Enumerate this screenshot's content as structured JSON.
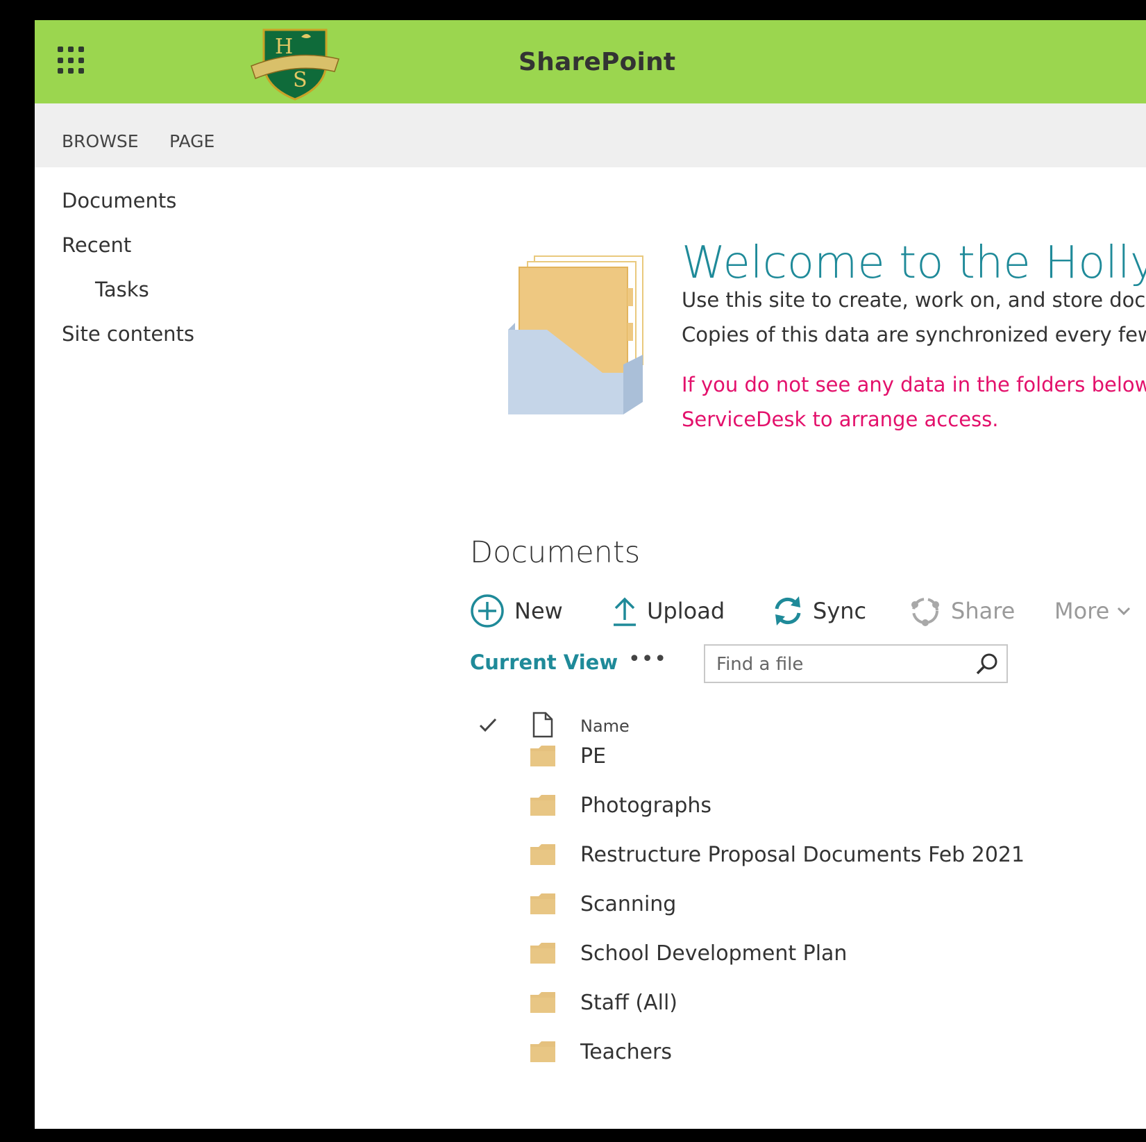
{
  "suite_bar": {
    "title": "SharePoint",
    "accent": "#9bd64f"
  },
  "ribbon": {
    "tabs": [
      "BROWSE",
      "PAGE"
    ]
  },
  "left_nav": {
    "items": [
      {
        "label": "Documents",
        "indent": false
      },
      {
        "label": "Recent",
        "indent": false
      },
      {
        "label": "Tasks",
        "indent": true
      },
      {
        "label": "Site contents",
        "indent": false
      }
    ]
  },
  "welcome": {
    "title": "Welcome to the Holly",
    "line1": "Use this site to create, work on, and store docu",
    "line2": "Copies of this data are synchronized every few",
    "warning1": "If you do not see any data in the folders below",
    "warning2": "ServiceDesk to arrange access.",
    "title_color": "#1f8a99",
    "warning_color": "#e3106b"
  },
  "documents": {
    "title": "Documents",
    "commands": {
      "new": "New",
      "upload": "Upload",
      "sync": "Sync",
      "share": "Share",
      "more": "More"
    },
    "current_view": "Current View",
    "ellipsis": "•••",
    "search": {
      "placeholder": "Find a file",
      "value": ""
    },
    "columns": {
      "name": "Name"
    },
    "rows": [
      "PE",
      "Photographs",
      "Restructure Proposal Documents Feb 2021",
      "Scanning",
      "School Development Plan",
      "Staff (All)",
      "Teachers"
    ]
  }
}
